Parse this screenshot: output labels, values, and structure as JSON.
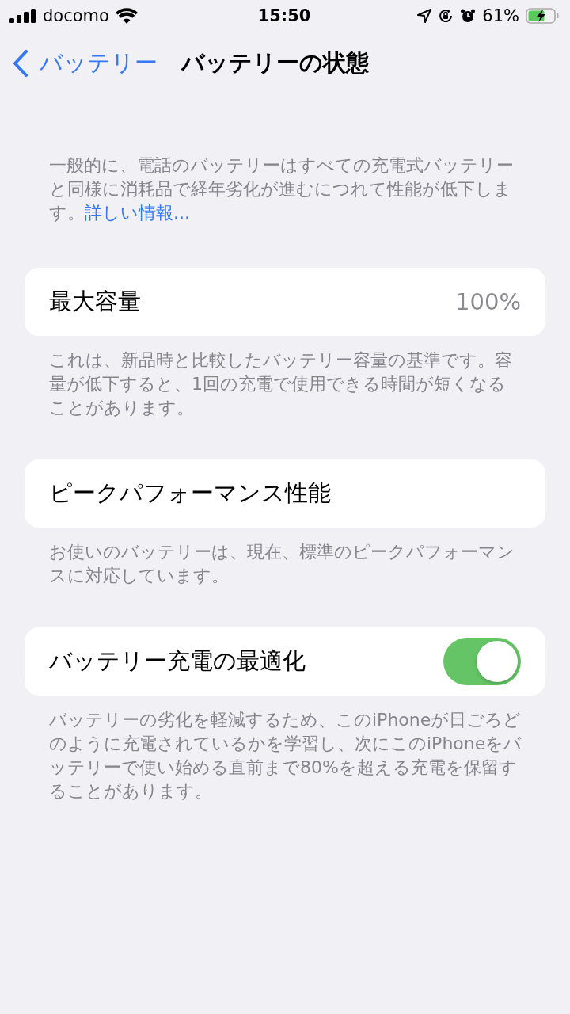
{
  "status_bar": {
    "carrier": "docomo",
    "time": "15:50",
    "battery_percent": "61%"
  },
  "nav": {
    "back_label": "バッテリー",
    "title": "バッテリーの状態"
  },
  "intro": {
    "text": "一般的に、電話のバッテリーはすべての充電式バッテリーと同様に消耗品で経年劣化が進むにつれて性能が低下します。",
    "link": "詳しい情報..."
  },
  "sections": [
    {
      "kind": "value",
      "label": "最大容量",
      "value": "100%",
      "footer": "これは、新品時と比較したバッテリー容量の基準です。容量が低下すると、1回の充電で使用できる時間が短くなることがあります。"
    },
    {
      "kind": "plain",
      "label": "ピークパフォーマンス性能",
      "footer": "お使いのバッテリーは、現在、標準のピークパフォーマンスに対応しています。"
    },
    {
      "kind": "toggle",
      "label": "バッテリー充電の最適化",
      "on": true,
      "footer": "バッテリーの劣化を軽減するため、このiPhoneが日ごろどのように充電されているかを学習し、次にこのiPhoneをバッテリーで使い始める直前まで80%を超える充電を保留することがあります。"
    }
  ]
}
